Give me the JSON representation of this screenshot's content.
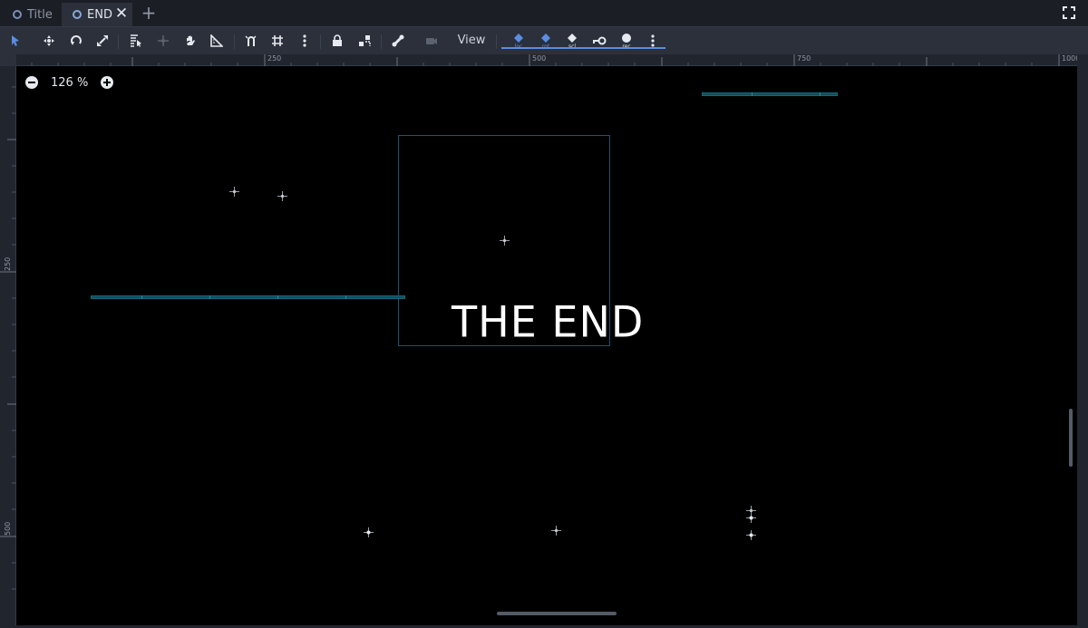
{
  "tabs": [
    {
      "label": "Title",
      "active": false
    },
    {
      "label": "END",
      "active": true
    }
  ],
  "toolbar": {
    "view_label": "View",
    "tools": [
      "select-tool",
      "move-tool",
      "rotate-tool",
      "scale-tool",
      "list-select-tool",
      "pivot-tool",
      "pan-tool",
      "ruler-tool",
      "smart-snap",
      "grid-snap",
      "snap-options",
      "lock",
      "group",
      "skeleton",
      "camera"
    ],
    "animation_keys": [
      "loc",
      "rot",
      "scl",
      "key",
      "rec"
    ]
  },
  "rulers": {
    "top": [
      "250",
      "500",
      "750",
      "1000"
    ],
    "left": [
      "250",
      "500"
    ]
  },
  "zoom": {
    "value": "126 %"
  },
  "scene": {
    "end_text": "THE END"
  },
  "colors": {
    "accent": "#5b8de0",
    "platform": "#0f4f5c",
    "viewport_bg": "#000000",
    "editor_bg": "#21252e"
  }
}
